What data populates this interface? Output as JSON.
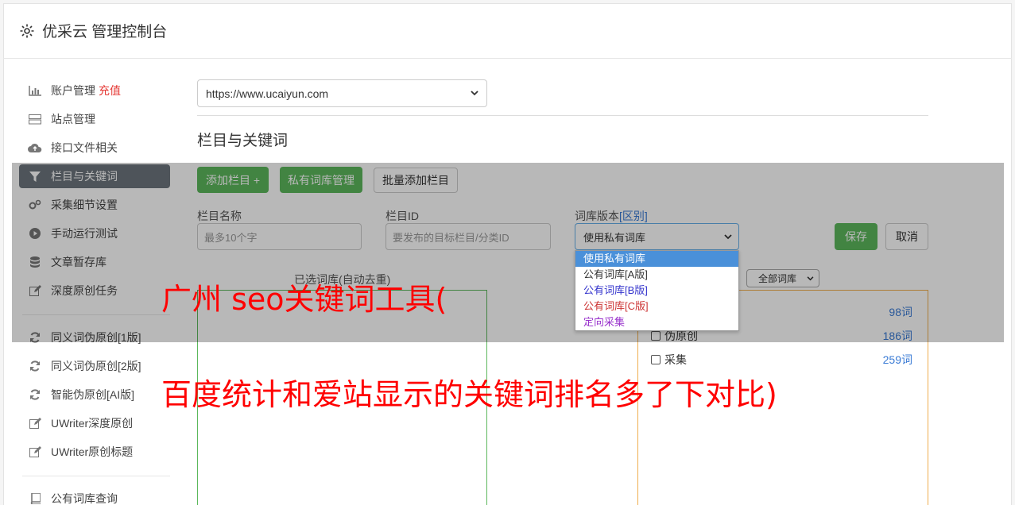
{
  "header": {
    "title": "优采云 管理控制台",
    "icon": "gear-icon"
  },
  "sidebar": {
    "items": [
      {
        "label": "账户管理",
        "badge": "充值",
        "icon": "bar-chart-icon"
      },
      {
        "label": "站点管理",
        "icon": "server-icon"
      },
      {
        "label": "接口文件相关",
        "icon": "cloud-upload-icon"
      },
      {
        "label": "栏目与关键词",
        "icon": "filter-icon",
        "active": true
      },
      {
        "label": "采集细节设置",
        "icon": "cogs-icon"
      },
      {
        "label": "手动运行测试",
        "icon": "play-circle-icon"
      },
      {
        "label": "文章暂存库",
        "icon": "database-icon"
      },
      {
        "label": "深度原创任务",
        "icon": "edit-icon"
      }
    ],
    "items2": [
      {
        "label": "同义词伪原创[1版]",
        "icon": "refresh-icon"
      },
      {
        "label": "同义词伪原创[2版]",
        "icon": "refresh-icon"
      },
      {
        "label": "智能伪原创[AI版]",
        "icon": "refresh-icon"
      },
      {
        "label": "UWriter深度原创",
        "icon": "edit-icon"
      },
      {
        "label": "UWriter原创标题",
        "icon": "edit-icon"
      }
    ],
    "items3": [
      {
        "label": "公有词库查询",
        "icon": "book-icon"
      }
    ]
  },
  "main": {
    "site_select": "https://www.ucaiyun.com",
    "section_title": "栏目与关键词",
    "buttons": {
      "add": "添加栏目 +",
      "private": "私有词库管理",
      "batch": "批量添加栏目"
    },
    "form": {
      "name_label": "栏目名称",
      "name_placeholder": "最多10个字",
      "id_label": "栏目ID",
      "id_placeholder": "要发布的目标栏目/分类ID",
      "version_label": "词库版本",
      "version_link": "[区别]",
      "version_value": "使用私有词库",
      "save": "保存",
      "cancel": "取消"
    },
    "dropdown_options": [
      {
        "label": "使用私有词库",
        "color": "#ffffff"
      },
      {
        "label": "公有词库[A版]",
        "color": "#333333"
      },
      {
        "label": "公有词库[B版]",
        "color": "#3333cc"
      },
      {
        "label": "公有词库[C版]",
        "color": "#cc3333"
      },
      {
        "label": "定向采集",
        "color": "#9933cc"
      }
    ],
    "selected_label": "已选词库(自动去重)",
    "filter_select": "全部词库",
    "word_rows": [
      {
        "label": "",
        "count": "98词"
      },
      {
        "label": "伪原创",
        "count": "186词"
      },
      {
        "label": "采集",
        "count": "259词"
      }
    ]
  },
  "overlay_text": {
    "line1": "广州 seo关键词工具(",
    "line2": "百度统计和爱站显示的关键词排名多了下对比)"
  }
}
